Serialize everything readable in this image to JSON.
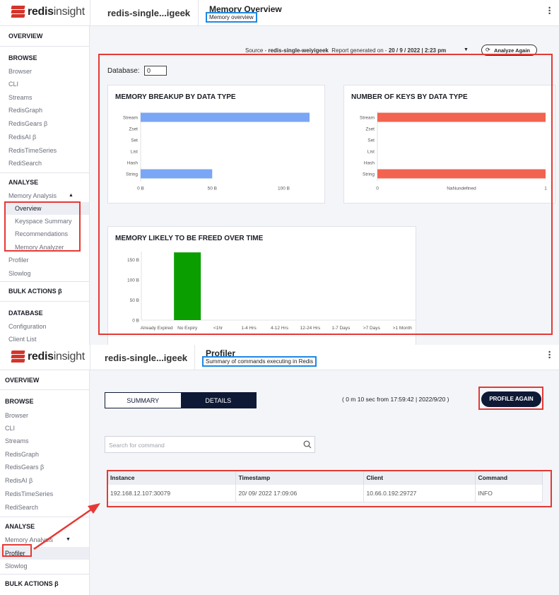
{
  "memory_screen": {
    "app": {
      "brand_bold": "redis",
      "brand_rest": "insight"
    },
    "header": {
      "db_name": "redis-single...igeek",
      "title": "Memory Overview",
      "subtitle": "Memory overview"
    },
    "sidebar": {
      "overview": "OVERVIEW",
      "browse_title": "BROWSE",
      "browse_items": [
        "Browser",
        "CLI",
        "Streams",
        "RedisGraph",
        "RedisGears β",
        "RedisAI β",
        "RedisTimeSeries",
        "RediSearch"
      ],
      "analyse_title": "ANALYSE",
      "memory_analysis": "Memory Analysis",
      "memory_sub": [
        "Overview",
        "Keyspace Summary",
        "Recommendations",
        "Memory Analyzer"
      ],
      "after_items": [
        "Profiler",
        "Slowlog"
      ],
      "bulk": "BULK ACTIONS β",
      "database_title": "DATABASE",
      "database_items": [
        "Configuration",
        "Client List"
      ]
    },
    "meta": {
      "source_label": "Source -",
      "source_value": "redis-single-weiyigeek",
      "report_label": "Report generated on -",
      "report_value": "20 / 9 / 2022 | 2:23 pm"
    },
    "analyze_button": "Analyze Again",
    "database_label": "Database:",
    "database_value": "0",
    "cards": {
      "breakup_title": "MEMORY BREAKUP BY DATA TYPE",
      "keys_title": "NUMBER OF KEYS BY DATA TYPE",
      "freed_title": "MEMORY LIKELY TO BE FREED OVER TIME"
    }
  },
  "profiler_screen": {
    "app": {
      "brand_bold": "redis",
      "brand_rest": "insight"
    },
    "header": {
      "db_name": "redis-single...igeek",
      "title": "Profiler",
      "subtitle": "Summary of commands executing in Redis"
    },
    "sidebar": {
      "overview": "OVERVIEW",
      "browse_title": "BROWSE",
      "browse_items": [
        "Browser",
        "CLI",
        "Streams",
        "RedisGraph",
        "RedisGears β",
        "RedisAI β",
        "RedisTimeSeries",
        "RediSearch"
      ],
      "analyse_title": "ANALYSE",
      "memory_analysis": "Memory Analysis",
      "profiler": "Profiler",
      "slowlog": "Slowlog",
      "bulk": "BULK ACTIONS β"
    },
    "tabs": [
      "SUMMARY",
      "DETAILS"
    ],
    "active_tab": "DETAILS",
    "duration": "( 0 m 10 sec from 17:59:42   |   2022/9/20 )",
    "profile_button": "PROFILE AGAIN",
    "search_placeholder": "Search for command",
    "table": {
      "headers": [
        "Instance",
        "Timestamp",
        "Client",
        "Command"
      ],
      "rows": [
        [
          "192.168.12.107:30079",
          "20/ 09/ 2022 17:09:06",
          "10.66.0.192:29727",
          "INFO"
        ]
      ]
    }
  },
  "colors": {
    "accent_red": "#d3352b",
    "navy": "#0e1935",
    "bar_blue": "#7aa6f5",
    "bar_red": "#f26450",
    "bar_green": "#0a9e00",
    "highlight_red": "#e53935",
    "highlight_blue": "#1e88e5"
  },
  "chart_data": [
    {
      "type": "bar",
      "title": "MEMORY BREAKUP BY DATA TYPE",
      "orientation": "horizontal",
      "categories": [
        "Stream",
        "Zset",
        "Set",
        "List",
        "Hash",
        "String"
      ],
      "values": [
        118,
        0,
        0,
        0,
        0,
        50
      ],
      "unit": "B",
      "xticks": [
        "0 B",
        "50 B",
        "100 B"
      ],
      "xlim": [
        0,
        118
      ],
      "color": "#7aa6f5"
    },
    {
      "type": "bar",
      "title": "NUMBER OF KEYS BY DATA TYPE",
      "orientation": "horizontal",
      "categories": [
        "Stream",
        "Zset",
        "Set",
        "List",
        "Hash",
        "String"
      ],
      "values": [
        1,
        0,
        0,
        0,
        0,
        1
      ],
      "xticks": [
        "0",
        "NaNundefined",
        "1"
      ],
      "xlim": [
        0,
        1
      ],
      "color": "#f26450"
    },
    {
      "type": "bar",
      "title": "MEMORY LIKELY TO BE FREED OVER TIME",
      "categories": [
        "Already Expired",
        "No Expiry",
        "<1hr",
        "1-4 Hrs",
        "4-12 Hrs",
        "12-24 Hrs",
        "1-7 Days",
        ">7 Days",
        ">1 Month"
      ],
      "values": [
        0,
        168,
        0,
        0,
        0,
        0,
        0,
        0,
        0
      ],
      "unit": "B",
      "yticks": [
        "0 B",
        "50 B",
        "100 B",
        "150 B"
      ],
      "ylim": [
        0,
        170
      ],
      "color": "#0a9e00"
    }
  ]
}
